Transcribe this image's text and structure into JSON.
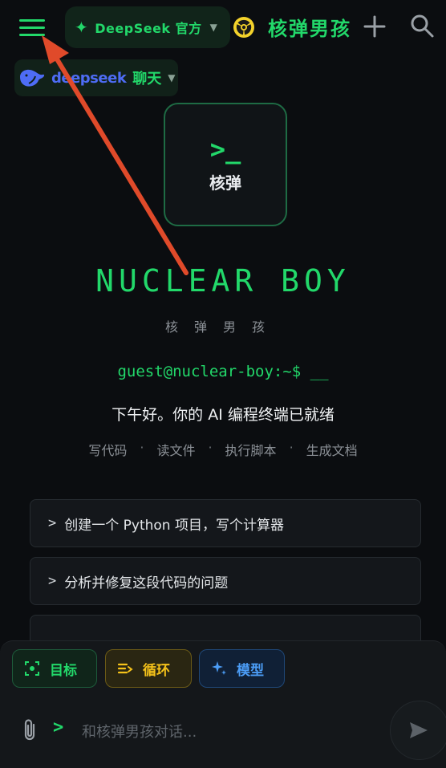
{
  "header": {
    "provider_label": "DeepSeek 官方",
    "app_title": "核弹男孩"
  },
  "mode": {
    "brand": "deepseek",
    "label": "聊天"
  },
  "logo": {
    "prompt": ">_",
    "label": "核弹"
  },
  "hero": {
    "title": "NUCLEAR BOY",
    "subtitle": "核弹男孩",
    "terminal": "guest@nuclear-boy:~$ __",
    "greeting": "下午好。你的 AI 编程终端已就绪"
  },
  "capabilities": [
    "写代码",
    "读文件",
    "执行脚本",
    "生成文档"
  ],
  "capability_separator": "·",
  "suggestions": [
    {
      "prefix": ">",
      "text": "创建一个 Python 项目，写个计算器"
    },
    {
      "prefix": ">",
      "text": "分析并修复这段代码的问题"
    },
    {
      "prefix": "",
      "text": ""
    }
  ],
  "composer": {
    "chips": [
      {
        "label": "目标",
        "icon": "focus-icon"
      },
      {
        "label": "循环",
        "icon": "loop-list-icon"
      },
      {
        "label": "模型",
        "icon": "sparkle-icon"
      }
    ],
    "prompt_glyph": ">",
    "placeholder": "和核弹男孩对话..."
  },
  "colors": {
    "accent_green": "#22d86a",
    "loop_yellow": "#f5c21a",
    "model_blue": "#4b9cf5",
    "annotation_red": "#e04a2a"
  },
  "icons": {
    "menu": "hamburger-menu-icon",
    "provider": "sparkle-icon",
    "radiation": "radiation-icon",
    "new_chat": "plus-icon",
    "search": "search-icon",
    "brand": "deepseek-whale-icon",
    "attach": "paperclip-icon",
    "send": "send-icon"
  }
}
